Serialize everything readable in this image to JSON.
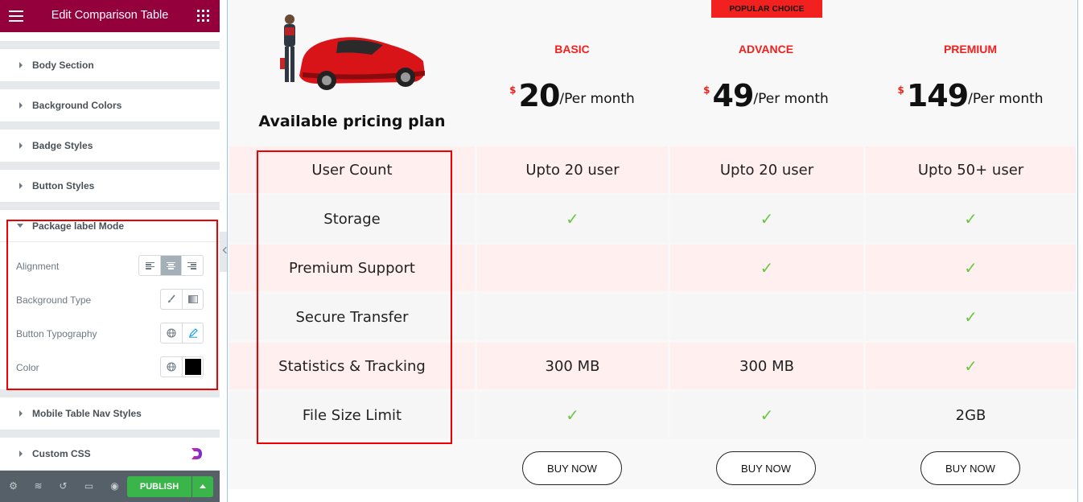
{
  "editor": {
    "title": "Edit Comparison Table",
    "sections": [
      {
        "label": "Body Section"
      },
      {
        "label": "Background Colors"
      },
      {
        "label": "Badge Styles"
      },
      {
        "label": "Button Styles"
      },
      {
        "label": "Package label Mode"
      },
      {
        "label": "Mobile Table Nav Styles"
      },
      {
        "label": "Custom CSS"
      }
    ],
    "controls": {
      "alignment": "Alignment",
      "background_type": "Background Type",
      "button_typography": "Button Typography",
      "color": "Color",
      "color_value": "#000000"
    },
    "publish_label": "PUBLISH"
  },
  "table": {
    "badge": "POPULAR CHOICE",
    "heading": "Available pricing plan",
    "packages": [
      {
        "name": "BASIC",
        "currency": "$",
        "amount": "20",
        "period": "/Per month",
        "button": "BUY NOW"
      },
      {
        "name": "ADVANCE",
        "currency": "$",
        "amount": "49",
        "period": "/Per month",
        "button": "BUY NOW"
      },
      {
        "name": "PREMIUM",
        "currency": "$",
        "amount": "149",
        "period": "/Per month",
        "button": "BUY NOW"
      }
    ],
    "rows": [
      {
        "feature": "User Count",
        "values": [
          "Upto 20 user",
          "Upto 20 user",
          "Upto 50+ user"
        ]
      },
      {
        "feature": "Storage",
        "values": [
          "✓",
          "✓",
          "✓"
        ]
      },
      {
        "feature": "Premium Support",
        "values": [
          "",
          "✓",
          "✓"
        ]
      },
      {
        "feature": "Secure Transfer",
        "values": [
          "",
          "",
          "✓"
        ]
      },
      {
        "feature": "Statistics & Tracking",
        "values": [
          "300 MB",
          "300 MB",
          "✓"
        ]
      },
      {
        "feature": "File Size Limit",
        "values": [
          "✓",
          "✓",
          "2GB"
        ]
      }
    ],
    "colors": {
      "accent": "#f2201e",
      "check": "#6cc644",
      "row_pink": "#fff0ef",
      "row_grey": "#f6f6f6"
    }
  }
}
